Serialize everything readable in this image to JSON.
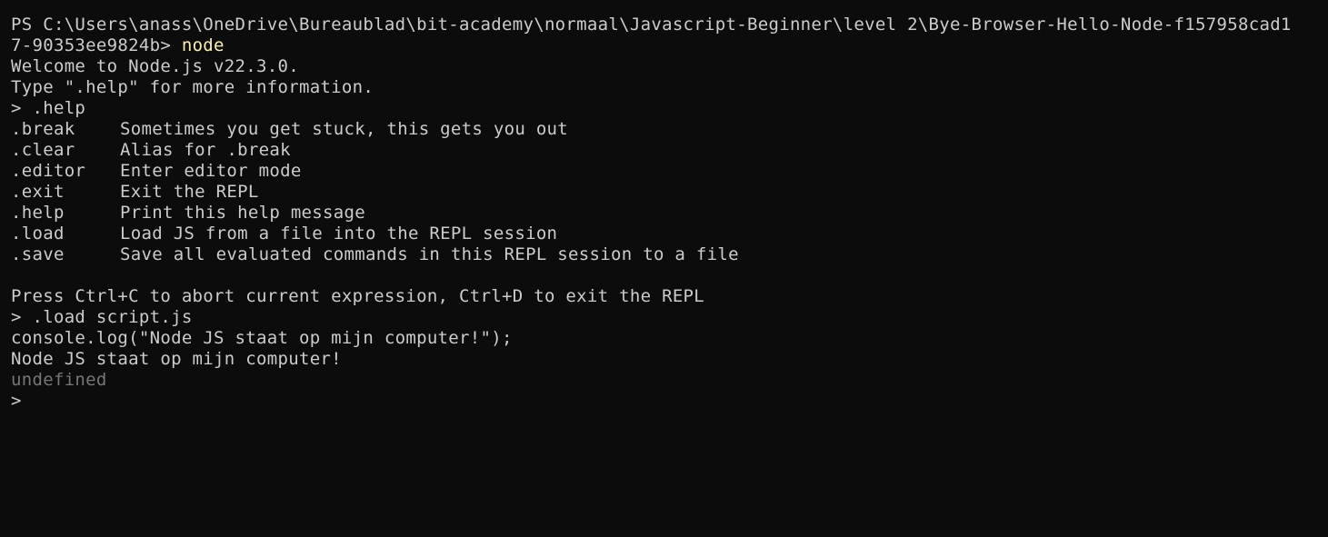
{
  "colors": {
    "background": "#0c0c0c",
    "foreground": "#cccccc",
    "command_highlight": "#f9f1a5",
    "dim_output": "#767676"
  },
  "terminal": {
    "ps_prompt_line1": "PS C:\\Users\\anass\\OneDrive\\Bureaublad\\bit-academy\\normaal\\Javascript-Beginner\\level 2\\Bye-Browser-Hello-Node-f157958cad1",
    "ps_prompt_line2": "7-90353ee9824b> ",
    "ps_command": "node",
    "welcome": "Welcome to Node.js v22.3.0.",
    "type_help": "Type \".help\" for more information.",
    "repl_help_input": "> .help",
    "help_entries": [
      {
        "command": ".break",
        "description": "Sometimes you get stuck, this gets you out"
      },
      {
        "command": ".clear",
        "description": "Alias for .break"
      },
      {
        "command": ".editor",
        "description": "Enter editor mode"
      },
      {
        "command": ".exit",
        "description": "Exit the REPL"
      },
      {
        "command": ".help",
        "description": "Print this help message"
      },
      {
        "command": ".load",
        "description": "Load JS from a file into the REPL session"
      },
      {
        "command": ".save",
        "description": "Save all evaluated commands in this REPL session to a file"
      }
    ],
    "abort_hint": "Press Ctrl+C to abort current expression, Ctrl+D to exit the REPL",
    "repl_load_input": "> .load script.js",
    "loaded_code": "console.log(\"Node JS staat op mijn computer!\");",
    "output": "Node JS staat op mijn computer!",
    "return_value": "undefined",
    "current_prompt": ">"
  }
}
